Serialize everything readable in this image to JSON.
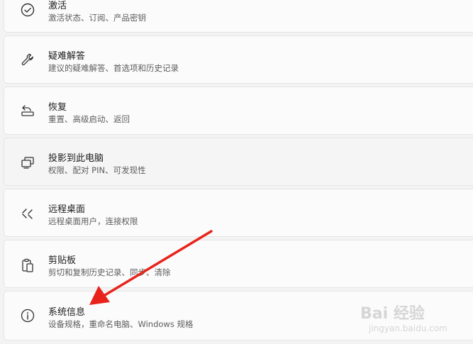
{
  "items": [
    {
      "icon": "activation-check-icon",
      "title": "激活",
      "subtitle": "激活状态、订阅、产品密钥"
    },
    {
      "icon": "wrench-icon",
      "title": "疑难解答",
      "subtitle": "建议的疑难解答、首选项和历史记录"
    },
    {
      "icon": "recovery-icon",
      "title": "恢复",
      "subtitle": "重置、高级启动、返回"
    },
    {
      "icon": "project-to-pc-icon",
      "title": "投影到此电脑",
      "subtitle": "权限、配对 PIN、可发现性"
    },
    {
      "icon": "remote-desktop-icon",
      "title": "远程桌面",
      "subtitle": "远程桌面用户，连接权限"
    },
    {
      "icon": "clipboard-icon",
      "title": "剪贴板",
      "subtitle": "剪切和复制历史记录、同步、清除"
    },
    {
      "icon": "info-icon",
      "title": "系统信息",
      "subtitle": "设备规格，重命名电脑、Windows 规格"
    }
  ],
  "watermark": {
    "brand": "Bai  经验",
    "url": "jingyan.baidu.com"
  },
  "colors": {
    "arrow": "#e8231c",
    "card": "#fbfbfb",
    "background": "#f3f3f3"
  }
}
